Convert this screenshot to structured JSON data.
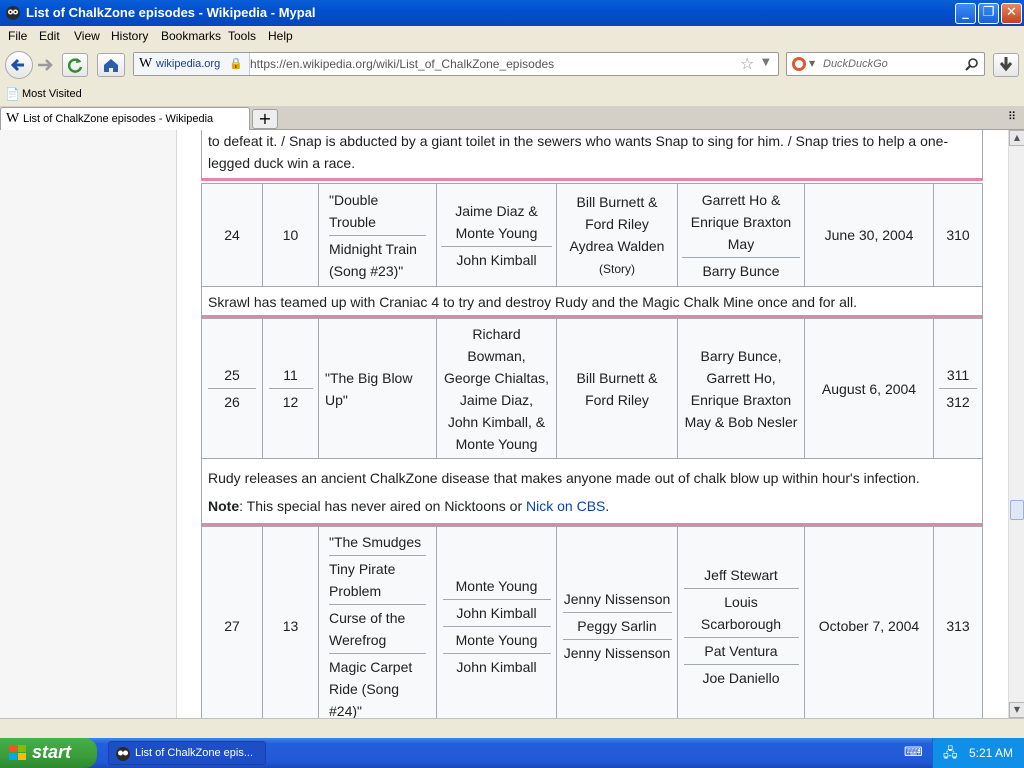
{
  "window": {
    "title": "List of ChalkZone episodes - Wikipedia - Mypal"
  },
  "menu": [
    "File",
    "Edit",
    "View",
    "History",
    "Bookmarks",
    "Tools",
    "Help"
  ],
  "nav": {
    "site_label": "wikipedia.org",
    "url": "https://en.wikipedia.org/wiki/List_of_ChalkZone_episodes",
    "search_placeholder": "DuckDuckGo"
  },
  "bookmarks": {
    "most_visited": "Most Visited"
  },
  "tab": {
    "label": "List of ChalkZone episodes - Wikipedia"
  },
  "table": {
    "top_summary": "to defeat it. / Snap is abducted by a giant toilet in the sewers who wants Snap to sing for him. / Snap tries to help a one-legged duck win a race.",
    "ep24": {
      "overall": "24",
      "season": "10",
      "title1": "\"Double Trouble",
      "title2": "Midnight Train (Song #23)\"",
      "dir1": "Jaime Diaz & Monte Young",
      "dir2": "John Kimball",
      "writer1": "Bill Burnett & Ford Riley",
      "writer2": "Aydrea Walden",
      "writer_note": "(Story)",
      "board1": "Garrett Ho & Enrique Braxton May",
      "board2": "Barry Bunce",
      "date": "June 30, 2004",
      "code": "310",
      "summary": "Skrawl has teamed up with Craniac 4 to try and destroy Rudy and the Magic Chalk Mine once and for all."
    },
    "ep25": {
      "overall1": "25",
      "overall2": "26",
      "season1": "11",
      "season2": "12",
      "title": "\"The Big Blow Up\"",
      "dir": "Richard Bowman, George Chialtas, Jaime Diaz, John Kimball, & Monte Young",
      "writer": "Bill Burnett & Ford Riley",
      "board": "Barry Bunce, Garrett Ho, Enrique Braxton May & Bob Nesler",
      "date": "August 6, 2004",
      "code1": "311",
      "code2": "312",
      "summary": "Rudy releases an ancient ChalkZone disease that makes anyone made out of chalk blow up within hour's infection.",
      "note_label": "Note",
      "note_text": ": This special has never aired on Nicktoons or ",
      "note_link": "Nick on CBS",
      "note_end": "."
    },
    "ep27": {
      "overall": "27",
      "season": "13",
      "title1": "\"The Smudges",
      "title2": "Tiny Pirate Problem",
      "title3": "Curse of the Werefrog",
      "title4": "Magic Carpet Ride (Song #24)\"",
      "dir1": "Monte Young",
      "dir2": "John Kimball",
      "dir3": "Monte Young",
      "dir4": "John Kimball",
      "writer1": "Jenny Nissenson",
      "writer2": "Peggy Sarlin",
      "writer3": "Jenny Nissenson",
      "board1": "Jeff Stewart",
      "board2": "Louis Scarborough",
      "board3": "Pat Ventura",
      "board4": "Joe Daniello",
      "date": "October 7, 2004",
      "code": "313"
    }
  },
  "taskbar": {
    "start": "start",
    "item": "List of ChalkZone epis...",
    "time": "5:21 AM"
  },
  "colors": {
    "row_divider": "#e586a8",
    "link": "#0645ad"
  }
}
